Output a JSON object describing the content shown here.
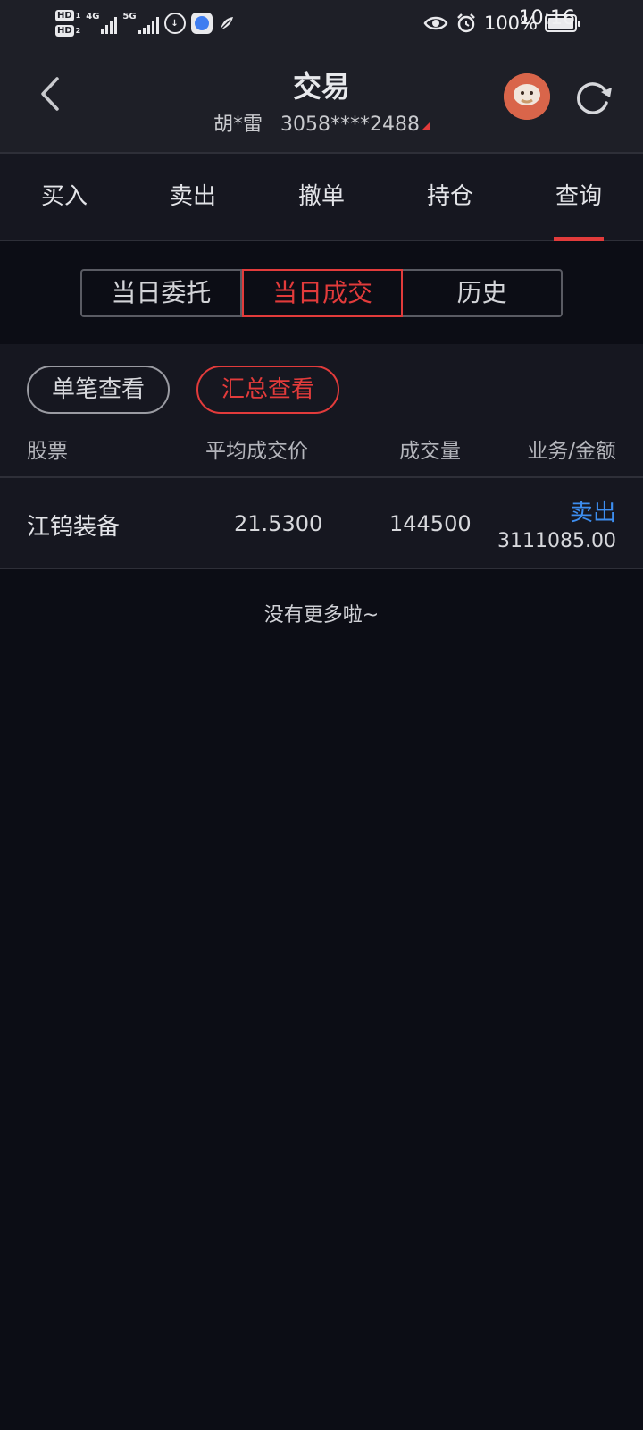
{
  "status_bar": {
    "hd1": "HD",
    "hd1_num": "1",
    "hd2": "HD",
    "hd2_num": "2",
    "net1": "4G",
    "net2": "5G",
    "battery_pct": "100%",
    "time": "10:16",
    "icons": [
      "hd-icon",
      "signal-icon",
      "data-saver-icon",
      "app-icon",
      "leaf-icon",
      "eye-icon",
      "alarm-icon",
      "battery-icon"
    ]
  },
  "header": {
    "title": "交易",
    "account_name": "胡*雷",
    "account_no": "3058****2488"
  },
  "tabs": [
    {
      "label": "买入"
    },
    {
      "label": "卖出"
    },
    {
      "label": "撤单"
    },
    {
      "label": "持仓"
    },
    {
      "label": "查询",
      "active": true
    }
  ],
  "segments": [
    {
      "label": "当日委托"
    },
    {
      "label": "当日成交",
      "active": true
    },
    {
      "label": "历史"
    }
  ],
  "view_modes": {
    "single": "单笔查看",
    "summary": "汇总查看"
  },
  "columns": {
    "stock": "股票",
    "avg_price": "平均成交价",
    "volume": "成交量",
    "biz_amount": "业务/金额"
  },
  "rows": [
    {
      "stock": "江钨装备",
      "avg_price": "21.5300",
      "volume": "144500",
      "direction": "卖出",
      "amount": "3111085.00"
    }
  ],
  "footer": {
    "no_more": "没有更多啦~"
  },
  "colors": {
    "accent_red": "#e23b3b",
    "sell_blue": "#3d8ef0",
    "background": "#0c0d15",
    "panel": "#161720"
  }
}
